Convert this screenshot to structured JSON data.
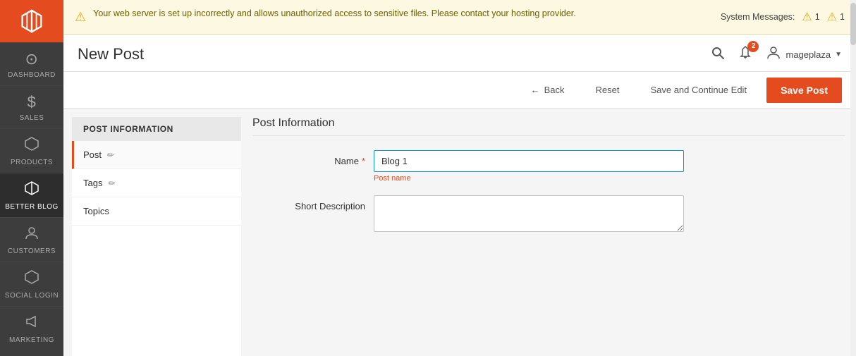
{
  "sidebar": {
    "logo_alt": "Magento Logo",
    "items": [
      {
        "id": "dashboard",
        "label": "DASHBOARD",
        "icon": "⊙"
      },
      {
        "id": "sales",
        "label": "SALES",
        "icon": "$"
      },
      {
        "id": "products",
        "label": "PRODUCTS",
        "icon": "⬡"
      },
      {
        "id": "better-blog",
        "label": "BETTER BLOG",
        "icon": "◎",
        "active": true
      },
      {
        "id": "customers",
        "label": "CUSTOMERS",
        "icon": "👤"
      },
      {
        "id": "social-login",
        "label": "SOCIAL LOGIN",
        "icon": "⬡"
      },
      {
        "id": "marketing",
        "label": "MARKETING",
        "icon": "📣"
      }
    ]
  },
  "warning": {
    "message": "Your web server is set up incorrectly and allows unauthorized access to sensitive files. Please contact your hosting provider.",
    "system_messages_label": "System Messages:",
    "msg_count_1": "1",
    "msg_count_2": "1"
  },
  "header": {
    "title": "New Post",
    "user_name": "mageplaza",
    "notification_count": "2"
  },
  "toolbar": {
    "back_label": "Back",
    "reset_label": "Reset",
    "save_continue_label": "Save and Continue Edit",
    "save_post_label": "Save Post"
  },
  "left_panel": {
    "section_title": "POST INFORMATION",
    "items": [
      {
        "id": "post",
        "label": "Post",
        "active": true
      },
      {
        "id": "tags",
        "label": "Tags"
      },
      {
        "id": "topics",
        "label": "Topics"
      }
    ]
  },
  "form": {
    "section_title": "Post Information",
    "name_label": "Name",
    "name_value": "Blog 1",
    "name_hint": "Post name",
    "short_description_label": "Short Description",
    "short_description_value": ""
  }
}
